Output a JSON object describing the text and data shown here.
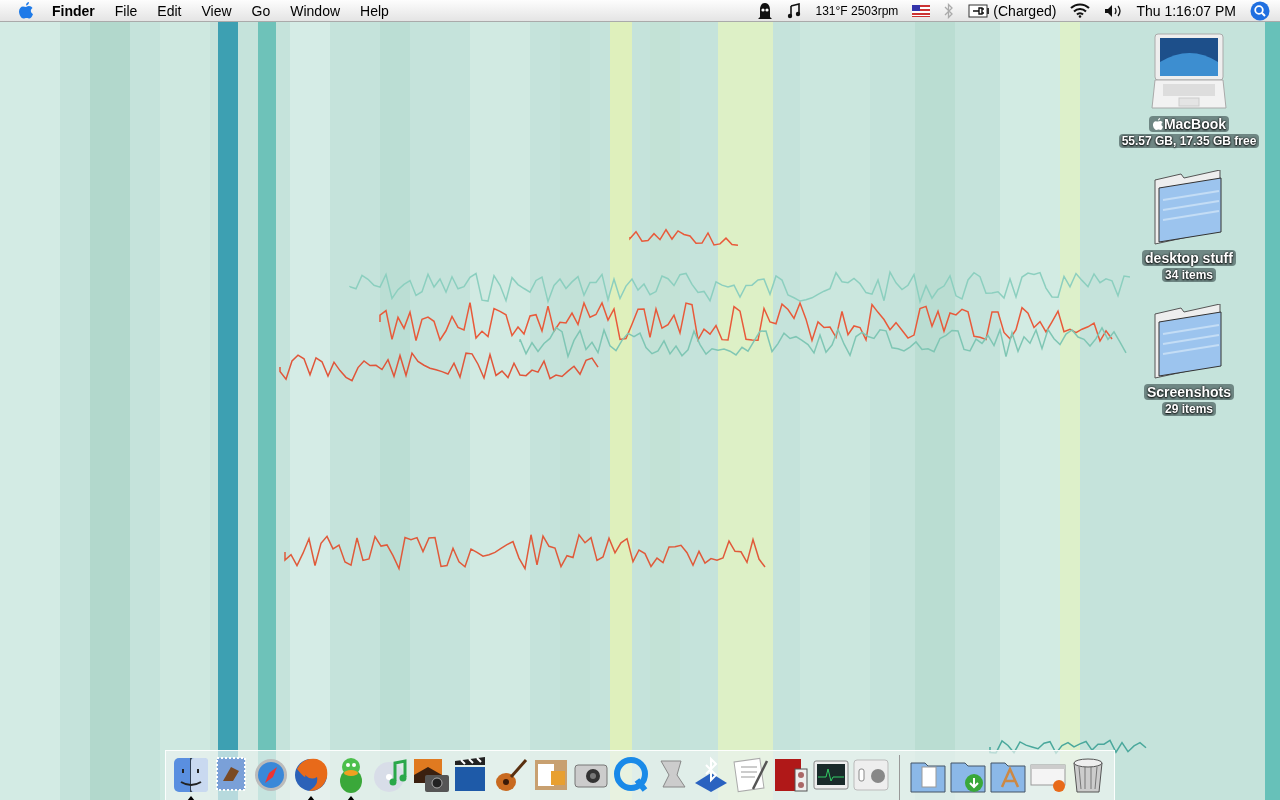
{
  "menu_bar": {
    "menus": [
      {
        "label": "Finder",
        "kind": "app"
      },
      {
        "label": "File",
        "kind": "menu"
      },
      {
        "label": "Edit",
        "kind": "menu"
      },
      {
        "label": "View",
        "kind": "menu"
      },
      {
        "label": "Go",
        "kind": "menu"
      },
      {
        "label": "Window",
        "kind": "menu"
      },
      {
        "label": "Help",
        "kind": "menu"
      }
    ],
    "status": {
      "temperature_fan": "131°F 2503rpm",
      "battery": "(Charged)",
      "clock": "Thu 1:16:07 PM"
    }
  },
  "desktop_icons": [
    {
      "kind": "laptop",
      "name": "MacBook",
      "info": "55.57 GB, 17.35 GB free"
    },
    {
      "kind": "folder",
      "name": "desktop stuff",
      "info": "34 items"
    },
    {
      "kind": "folder",
      "name": "Screenshots",
      "info": "29 items"
    }
  ],
  "dock": {
    "apps": [
      {
        "running": true
      },
      {
        "running": false
      },
      {
        "running": false
      },
      {
        "running": true
      },
      {
        "running": true
      },
      {
        "running": false
      },
      {
        "running": false
      },
      {
        "running": false
      },
      {
        "running": false
      },
      {
        "running": false
      },
      {
        "running": false
      },
      {
        "running": false
      },
      {
        "running": false
      },
      {
        "running": false
      },
      {
        "running": false
      },
      {
        "running": false
      },
      {
        "running": false
      },
      {
        "running": false
      }
    ]
  }
}
